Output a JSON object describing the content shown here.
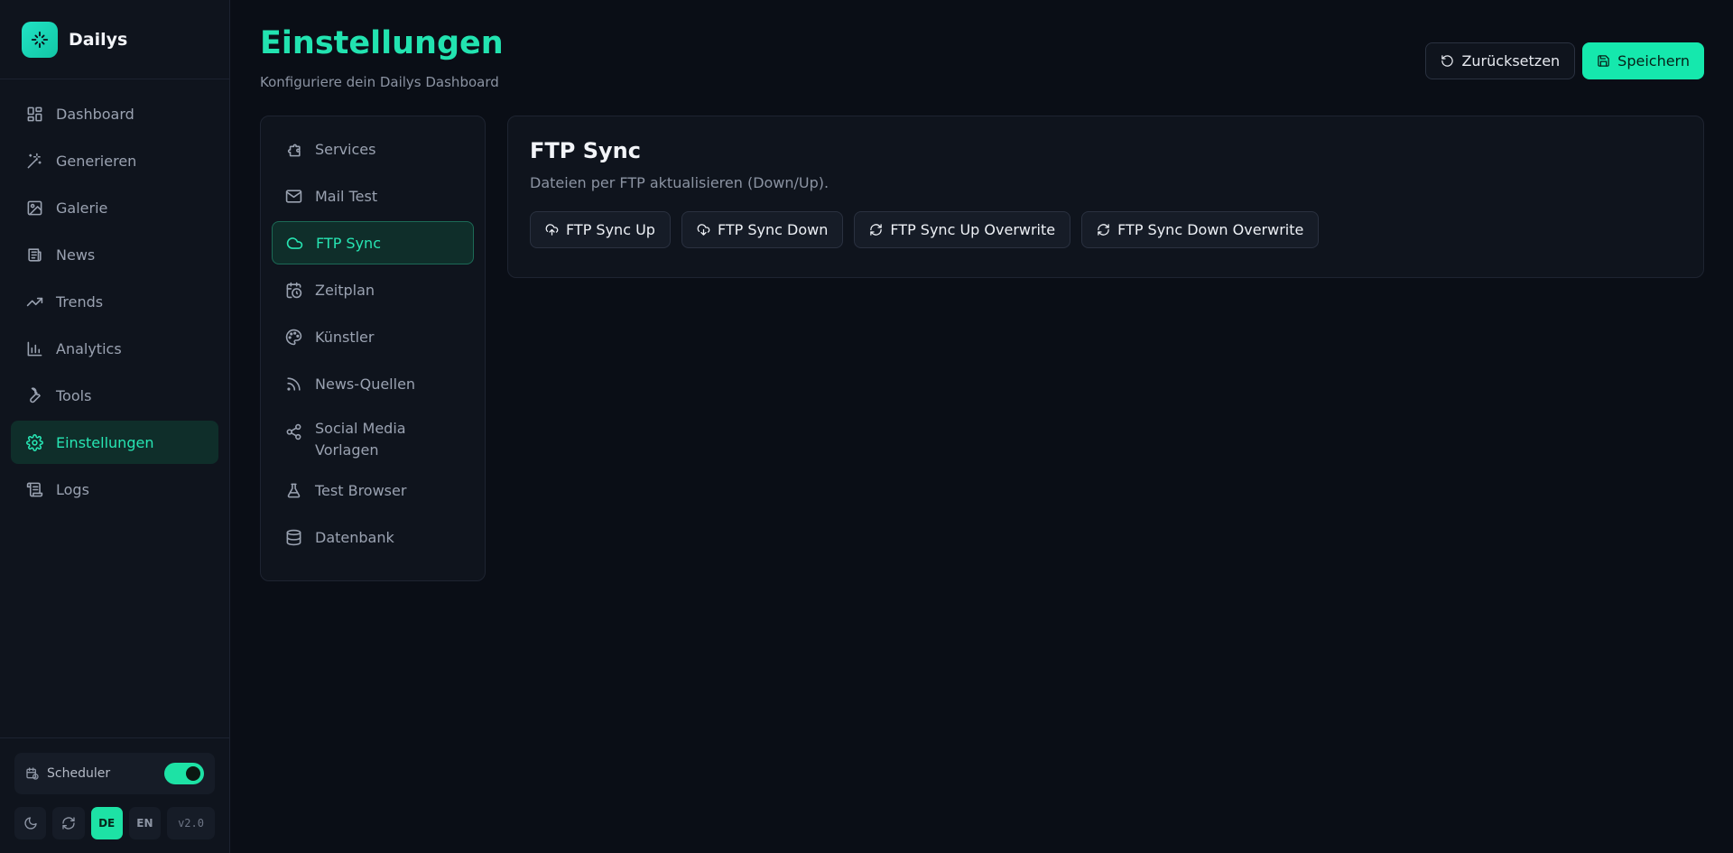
{
  "app": {
    "name": "Dailys"
  },
  "sidebar": {
    "items": [
      {
        "label": "Dashboard",
        "icon": "layout-dashboard-icon"
      },
      {
        "label": "Generieren",
        "icon": "magic-wand-icon"
      },
      {
        "label": "Galerie",
        "icon": "image-icon"
      },
      {
        "label": "News",
        "icon": "newspaper-icon"
      },
      {
        "label": "Trends",
        "icon": "trending-up-icon"
      },
      {
        "label": "Analytics",
        "icon": "bar-chart-icon"
      },
      {
        "label": "Tools",
        "icon": "wrench-icon"
      },
      {
        "label": "Einstellungen",
        "icon": "gear-icon",
        "active": true
      },
      {
        "label": "Logs",
        "icon": "scroll-icon"
      }
    ],
    "scheduler": {
      "label": "Scheduler",
      "enabled": true
    },
    "languages": [
      "DE",
      "EN"
    ],
    "active_language": "DE",
    "version": "v2.0"
  },
  "header": {
    "title": "Einstellungen",
    "subtitle": "Konfiguriere dein Dailys Dashboard",
    "reset_label": "Zurücksetzen",
    "save_label": "Speichern"
  },
  "settings_nav": {
    "items": [
      {
        "label": "Services",
        "icon": "puzzle-icon"
      },
      {
        "label": "Mail Test",
        "icon": "mail-icon"
      },
      {
        "label": "FTP Sync",
        "icon": "cloud-icon",
        "active": true
      },
      {
        "label": "Zeitplan",
        "icon": "calendar-clock-icon"
      },
      {
        "label": "Künstler",
        "icon": "palette-icon"
      },
      {
        "label": "News-Quellen",
        "icon": "rss-icon"
      },
      {
        "label": "Social Media Vorlagen",
        "icon": "share-icon"
      },
      {
        "label": "Test Browser",
        "icon": "flask-icon"
      },
      {
        "label": "Datenbank",
        "icon": "database-icon"
      }
    ]
  },
  "ftp": {
    "title": "FTP Sync",
    "description": "Dateien per FTP aktualisieren (Down/Up).",
    "buttons": [
      {
        "label": "FTP Sync Up",
        "icon": "cloud-upload-icon"
      },
      {
        "label": "FTP Sync Down",
        "icon": "cloud-download-icon"
      },
      {
        "label": "FTP Sync Up Overwrite",
        "icon": "refresh-icon"
      },
      {
        "label": "FTP Sync Down Overwrite",
        "icon": "refresh-icon"
      }
    ]
  },
  "colors": {
    "accent": "#22e3b0",
    "background": "#0a0e16",
    "panel": "#0f141d",
    "active_bg": "#0f2e2a"
  }
}
